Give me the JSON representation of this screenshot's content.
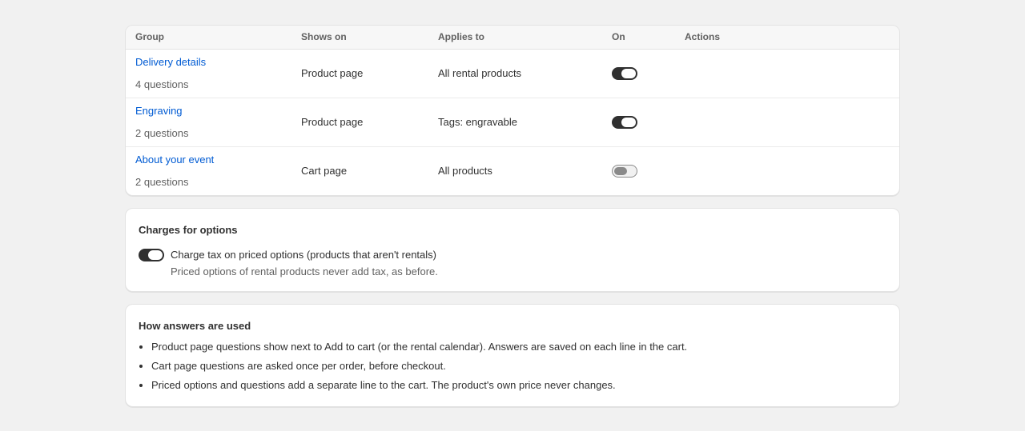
{
  "table": {
    "headers": {
      "group": "Group",
      "shows_on": "Shows on",
      "applies_to": "Applies to",
      "on": "On",
      "actions": "Actions"
    },
    "rows": [
      {
        "name": "Delivery details",
        "count": "4 questions",
        "shows_on": "Product page",
        "applies_to": "All rental products",
        "on": true
      },
      {
        "name": "Engraving",
        "count": "2 questions",
        "shows_on": "Product page",
        "applies_to": "Tags: engravable",
        "on": true
      },
      {
        "name": "About your event",
        "count": "2 questions",
        "shows_on": "Cart page",
        "applies_to": "All products",
        "on": false
      }
    ]
  },
  "charges": {
    "title": "Charges for options",
    "toggle_on": true,
    "label": "Charge tax on priced options (products that aren't rentals)",
    "help": "Priced options of rental products never add tax, as before."
  },
  "how": {
    "title": "How answers are used",
    "items": [
      "Product page questions show next to Add to cart (or the rental calendar). Answers are saved on each line in the cart.",
      "Cart page questions are asked once per order, before checkout.",
      "Priced options and questions add a separate line to the cart. The product's own price never changes."
    ]
  },
  "colors": {
    "page_bg": "#f1f1f1",
    "link": "#005bd3",
    "toggle_on": "#303030",
    "toggle_off_knob": "#8a8a8a"
  }
}
